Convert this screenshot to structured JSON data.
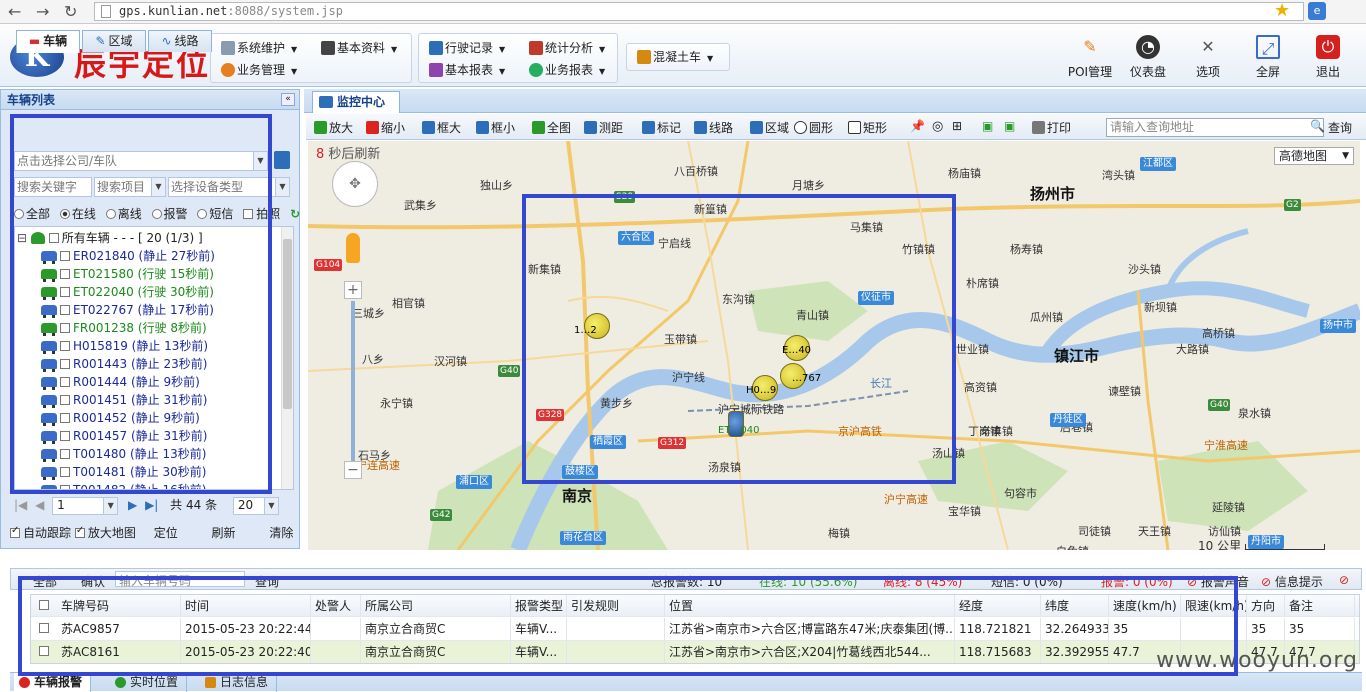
{
  "browser": {
    "url_host": "gps.kunlian.net",
    "url_rest": ":8088/system.jsp"
  },
  "header": {
    "logo_letter": "K",
    "logo_text": "辰宇定位",
    "menu": [
      {
        "label": "系统维护"
      },
      {
        "label": "基本资料"
      },
      {
        "label": "业务管理"
      },
      {
        "label": "行驶记录"
      },
      {
        "label": "统计分析"
      },
      {
        "label": "基本报表"
      },
      {
        "label": "业务报表"
      },
      {
        "label": "混凝土车"
      }
    ],
    "tools": [
      {
        "label": "POI管理"
      },
      {
        "label": "仪表盘"
      },
      {
        "label": "选项"
      },
      {
        "label": "全屏"
      },
      {
        "label": "退出"
      }
    ]
  },
  "left": {
    "title": "车辆列表",
    "collapse": "«",
    "tabs": [
      {
        "label": "车辆"
      },
      {
        "label": "区域"
      },
      {
        "label": "线路"
      }
    ],
    "company_placeholder": "点击选择公司/车队",
    "keyword_placeholder": "搜索关键字",
    "search_item": "搜索项目",
    "device_type": "选择设备类型",
    "filters": [
      "全部",
      "在线",
      "离线",
      "报警",
      "短信",
      "拍照"
    ],
    "tree_root": "所有车辆 - - - [ 20 (1/3) ]",
    "vehicles": [
      {
        "text": "ER021840 (静止 27秒前)",
        "color": "#1a2a9a",
        "icon": "#3a6bc8"
      },
      {
        "text": "ET021580 (行驶 15秒前)",
        "color": "#1a8a1a",
        "icon": "#2a9a2a"
      },
      {
        "text": "ET022040 (行驶 30秒前)",
        "color": "#1a8a1a",
        "icon": "#2a9a2a"
      },
      {
        "text": "ET022767 (静止 17秒前)",
        "color": "#1a2a9a",
        "icon": "#3a6bc8"
      },
      {
        "text": "FR001238 (行驶 8秒前)",
        "color": "#1a8a1a",
        "icon": "#2a9a2a"
      },
      {
        "text": "H015819 (静止 13秒前)",
        "color": "#1a2a9a",
        "icon": "#3a6bc8"
      },
      {
        "text": "R001443 (静止 23秒前)",
        "color": "#1a2a9a",
        "icon": "#3a6bc8"
      },
      {
        "text": "R001444 (静止 9秒前)",
        "color": "#1a2a9a",
        "icon": "#3a6bc8"
      },
      {
        "text": "R001451 (静止 31秒前)",
        "color": "#1a2a9a",
        "icon": "#3a6bc8"
      },
      {
        "text": "R001452 (静止 9秒前)",
        "color": "#1a2a9a",
        "icon": "#3a6bc8"
      },
      {
        "text": "R001457 (静止 31秒前)",
        "color": "#1a2a9a",
        "icon": "#3a6bc8"
      },
      {
        "text": "T001480 (静止 13秒前)",
        "color": "#1a2a9a",
        "icon": "#3a6bc8"
      },
      {
        "text": "T001481 (静止 30秒前)",
        "color": "#1a2a9a",
        "icon": "#3a6bc8"
      },
      {
        "text": "T001482 (静止 16秒前)",
        "color": "#1a2a9a",
        "icon": "#3a6bc8"
      }
    ],
    "pager": {
      "page": "1",
      "total": "共 44 条",
      "size": "20"
    },
    "options": [
      "自动跟踪",
      "放大地图"
    ],
    "actions": [
      "定位",
      "刷新",
      "清除"
    ]
  },
  "main": {
    "tab": "监控中心",
    "toolbar": [
      "放大",
      "缩小",
      "框大",
      "框小",
      "全图",
      "测距",
      "标记",
      "线路",
      "区域",
      "圆形",
      "矩形"
    ],
    "print": "打印",
    "address_placeholder": "请输入查询地址",
    "query": "查询",
    "refresh_num": "8",
    "refresh_text": " 秒后刷新",
    "map_type": "高德地图",
    "scale": "10 公里"
  },
  "map": {
    "cities": [
      {
        "name": "扬州市",
        "cls": "city"
      },
      {
        "name": "镇江市",
        "cls": "city"
      },
      {
        "name": "南京",
        "cls": "city"
      }
    ],
    "places": [
      "八百桥镇",
      "月塘乡",
      "杨庙镇",
      "湾头镇",
      "独山乡",
      "新篁镇",
      "马集镇",
      "武集乡",
      "新集镇",
      "宁启线",
      "杨寿镇",
      "竹镇镇",
      "朴席镇",
      "沙头镇",
      "相官镇",
      "东沟镇",
      "青山镇",
      "瓜州镇",
      "新坝镇",
      "三城乡",
      "汉河镇",
      "玉带镇",
      "世业镇",
      "高桥镇",
      "大路镇",
      "八乡",
      "黄步乡",
      "长江",
      "沪宁线",
      "高资镇",
      "谏壁镇",
      "永宁镇",
      "沪宁城际铁路",
      "丁岗镇",
      "泉水镇",
      "石马乡",
      "辛丰镇",
      "后巷镇",
      "宁淮高速",
      "京沪高铁",
      "沪宁高速",
      "宁连高速",
      "汤泉镇",
      "宝华镇",
      "句容市",
      "司徒镇",
      "天王镇",
      "白兔镇",
      "访仙镇",
      "延陵镇",
      "梅镇",
      "汤山镇",
      "浦口区",
      "栖霞区",
      "鼓楼区",
      "雨花台区",
      "六合区",
      "仪征市",
      "丹徒区",
      "丹阳市",
      "江都区",
      "扬中市"
    ],
    "road_tags": [
      "G104",
      "G40",
      "G328",
      "G312",
      "G42",
      "G2",
      "S29",
      "G40"
    ],
    "markers": [
      {
        "label": "1…2"
      },
      {
        "label": "E…40"
      },
      {
        "label": "…767"
      },
      {
        "label": "H0…9"
      },
      {
        "label": "ET…040"
      }
    ]
  },
  "grid": {
    "toolbar_left": [
      "全部",
      "确认",
      "输入车辆号码",
      "查询"
    ],
    "toolbar_right": [
      "总报警数: 10",
      "在线: 10 (55.6%)",
      "离线: 8 (45%)",
      "短信: 0 (0%)",
      "报警: 0 (0%)",
      "报警声音",
      "信息提示"
    ],
    "columns": [
      "车牌号码",
      "时间",
      "处警人",
      "所属公司",
      "报警类型",
      "引发规则",
      "位置",
      "经度",
      "纬度",
      "速度(km/h)",
      "限速(km/h)",
      "方向",
      "备注"
    ],
    "rows": [
      [
        "苏AC9857",
        "2015-05-23 20:22:44",
        "",
        "南京立合商贸C",
        "车辆V...",
        "",
        "江苏省>南京市>六合区;博富路东47米;庆泰集团(博...",
        "118.721821",
        "32.264933",
        "35",
        "",
        "35",
        "35"
      ],
      [
        "苏AC8161",
        "2015-05-23 20:22:40",
        "",
        "南京立合商贸C",
        "车辆V...",
        "",
        "江苏省>南京市>六合区;X204|竹葛线西北544...",
        "118.715683",
        "32.392955",
        "47.7",
        "",
        "47.7",
        "47.7"
      ]
    ],
    "tabs": [
      "车辆报警",
      "实时位置",
      "日志信息"
    ]
  },
  "watermark": "www.wooyun.org",
  "colors": {
    "annotation": "#3447d0",
    "logo_red": "#d81818",
    "panel_blue": "#15428b"
  }
}
